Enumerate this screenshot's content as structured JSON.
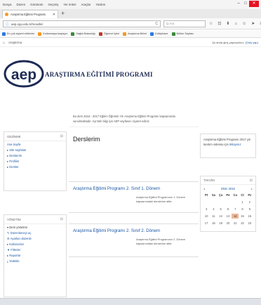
{
  "browser": {
    "menu": [
      "Dosya",
      "Düzen",
      "Görünüm",
      "Geçmiş",
      "Yer imleri",
      "Araçlar",
      "Yardım"
    ],
    "window_controls": [
      "–",
      "□",
      "✕"
    ],
    "tab_title": "Araştırma Eğitimi Programı",
    "tab_close": "✕",
    "new_tab": "+",
    "url": "aep.ogu.edu.tr/moodle/",
    "reload": "C",
    "search_placeholder": "Q Ara",
    "nav_icons": [
      "☆",
      "⊡",
      "⬇",
      "⌂",
      "☺",
      "➤",
      "≡"
    ],
    "bookmarks": [
      {
        "label": "En çok ziyaret edilenler",
        "color": "#2a7ae2"
      },
      {
        "label": "Kullanmaya başlayın",
        "color": "#f59a23"
      },
      {
        "label": "Sağlık Bakanlığı",
        "color": "#3a8a3a"
      },
      {
        "label": "Öğrenci İşleri",
        "color": "#c0392b"
      },
      {
        "label": "Araştırma Birimi",
        "color": "#f59a23"
      },
      {
        "label": "Kütüphane",
        "color": "#2a7ae2"
      },
      {
        "label": "Bölüm Sayfası",
        "color": "#3a8a3a"
      }
    ]
  },
  "site": {
    "home_icon": "⌂",
    "brand": "Araştırma",
    "login_text": "Şu anda giriş yapmadınız. ",
    "login_link": "(Giriş yap)",
    "logo_text": "aep",
    "title": "ARAŞTIRMA EĞİTİMİ PROGRAMI"
  },
  "nav_block": {
    "title": "GEZİNME",
    "collapse": "⊟",
    "items": [
      "Ana Sayfa",
      "▸ Site sayfaları",
      "▸ Derslerim",
      "▸ Profilim",
      "▸ Dersler"
    ]
  },
  "admin_block": {
    "title": "YÖNETİM",
    "collapse": "⊟",
    "items": [
      "▾ Ders yönetimi",
      "✎ Düzenlemeyi aç",
      "⚙ Ayarları düzenle",
      "▸ Kullanıcılar",
      "▼ Filtreler",
      "▸ Raporlar",
      "⤓ Yedekle"
    ]
  },
  "main": {
    "intro": "Bu ders 2016 - 2017 Eğitim Öğretim Yılı Araştırma Eğitimi Programı kapsamında sunulmaktadır. Ayrıntılı bilgi için AEP sayfasını ziyaret ediniz.",
    "section_title": "Derslerim",
    "courses": [
      {
        "title": "Araştırma Eğitimi Programı 2. Sınıf 1. Dönem",
        "desc": "Araştırma Eğitimi Programının 1. Dönem kapsamındaki derslerine aittir."
      },
      {
        "title": "Araştırma Eğitimi Programı 2. Sınıf 2. Dönem",
        "desc": "Araştırma Eğitimi Programının 2. Dönem kapsamındaki derslerine aittir."
      }
    ]
  },
  "info_block": {
    "text": "Araştırma Eğitimi Programı 2017 yılı tanıtım videosu için ",
    "link": "tıklayınız"
  },
  "calendar": {
    "title": "TAKVİM",
    "collapse": "⊟",
    "prev": "◂",
    "month": "Ekim 2016",
    "next": "▸",
    "weekdays": [
      "Pt",
      "Sa",
      "Ça",
      "Pe",
      "Cu",
      "Ct",
      "Pz"
    ],
    "cells": [
      "",
      "",
      "",
      "",
      "",
      "1",
      "2",
      "3",
      "4",
      "5",
      "6",
      "7",
      "8",
      "9",
      "10",
      "11",
      "12",
      "13",
      "14",
      "15",
      "16",
      "17",
      "18",
      "19",
      "20",
      "21",
      "22",
      "23"
    ],
    "today": "14"
  }
}
